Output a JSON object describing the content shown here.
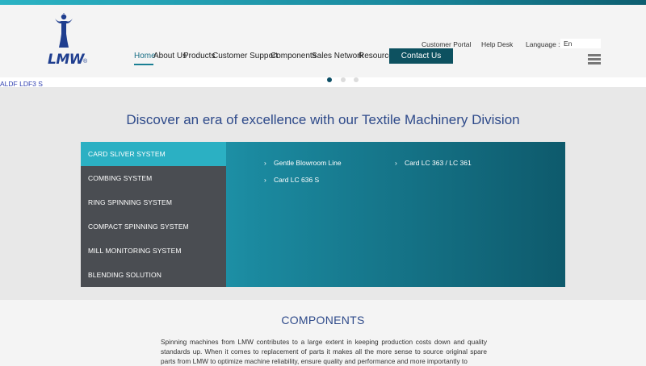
{
  "brand": {
    "logo_text": "LMW",
    "logo_mark": "®"
  },
  "utility": {
    "customer_portal": "Customer Portal",
    "help_desk": "Help Desk",
    "language_label": "Language :",
    "language_value": "En"
  },
  "nav": {
    "items": [
      {
        "label": "Home",
        "active": true
      },
      {
        "label": "About Us"
      },
      {
        "label": "Products"
      },
      {
        "label": "Customer Support"
      },
      {
        "label": "Components"
      },
      {
        "label": "Sales Network"
      },
      {
        "label": "Resource"
      }
    ],
    "contact_label": "Contact Us"
  },
  "carousel": {
    "slide_count": 3,
    "active_index": 0,
    "broken_text": "ALDF LDF3 S"
  },
  "hero": {
    "heading": "Discover an era of excellence with our Textile Machinery Division",
    "menu": [
      {
        "label": "CARD SLIVER SYSTEM",
        "active": true
      },
      {
        "label": "COMBING SYSTEM"
      },
      {
        "label": "RING SPINNING SYSTEM"
      },
      {
        "label": "COMPACT SPINNING SYSTEM"
      },
      {
        "label": "MILL MONITORING SYSTEM"
      },
      {
        "label": "BLENDING SOLUTION"
      }
    ],
    "products": [
      "Gentle Blowroom Line",
      "Card LC 363 / LC 361",
      "Card LC 636 S"
    ]
  },
  "components": {
    "title": "COMPONENTS",
    "text": "Spinning machines from LMW contributes to a large extent in keeping production costs down and quality standards up. When it comes to replacement of parts it makes all the more sense to source original spare parts from LMW to optimize machine reliability, ensure quality and performance and more importantly to"
  },
  "colors": {
    "accent": "#2bb0c3",
    "dark_teal": "#0d5160",
    "brand_blue": "#1f3e8f",
    "menu_bg": "#4a4d52"
  }
}
